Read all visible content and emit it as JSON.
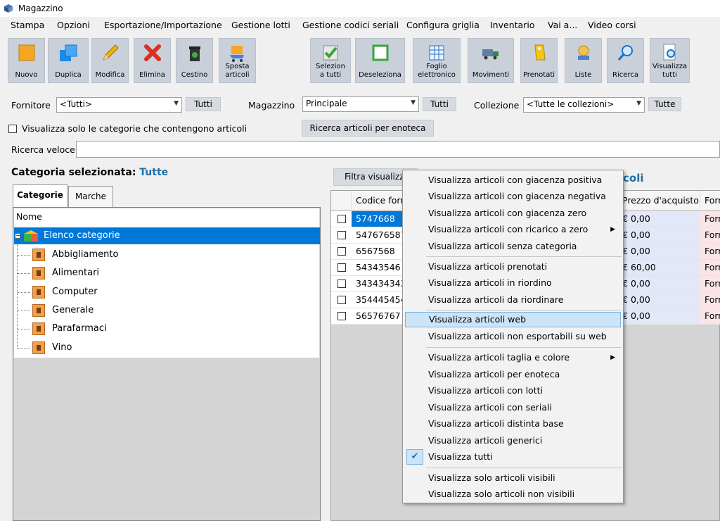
{
  "window": {
    "title": "Magazzino"
  },
  "menubar": [
    "Stampa",
    "Opzioni",
    "Esportazione/Importazione",
    "Gestione lotti",
    "Gestione codici seriali",
    "Configura griglia",
    "Inventario",
    "Vai a...",
    "Video corsi"
  ],
  "toolbar": {
    "nuovo": "Nuovo",
    "duplica": "Duplica",
    "modifica": "Modifica",
    "elimina": "Elimina",
    "cestino": "Cestino",
    "sposta_1": "Sposta",
    "sposta_2": "articoli",
    "seleziona_1": "Selezion",
    "seleziona_2": "a tutti",
    "deseleziona": "Deseleziona",
    "foglio_1": "Foglio",
    "foglio_2": "elettronico",
    "movimenti": "Movimenti",
    "prenotati": "Prenotati",
    "liste": "Liste",
    "ricerca": "Ricerca",
    "visualizza_1": "Visualizza",
    "visualizza_2": "tutti"
  },
  "filters": {
    "fornitore_label": "Fornitore",
    "fornitore_value": "<Tutti>",
    "fornitore_btn": "Tutti",
    "magazzino_label": "Magazzino",
    "magazzino_value": "Principale",
    "magazzino_btn": "Tutti",
    "collezione_label": "Collezione",
    "collezione_value": "<Tutte le collezioni>",
    "collezione_btn": "Tutte",
    "solo_categorie": "Visualizza solo le categorie che contengono articoli",
    "enoteca_btn": "Ricerca articoli per enoteca",
    "ricerca_label": "Ricerca veloce",
    "ricerca_value": ""
  },
  "left": {
    "categoria_label": "Categoria selezionata:",
    "categoria_value": "Tutte",
    "tabs": [
      "Categorie",
      "Marche"
    ],
    "tree_header": "Nome",
    "root": "Elenco categorie",
    "categories": [
      "Abbigliamento",
      "Alimentari",
      "Computer",
      "Generale",
      "Parafarmaci",
      "Vino"
    ]
  },
  "grid": {
    "filter_btn": "Filtra visualizza",
    "title_fragment": "coli",
    "columns": [
      "Codice forn",
      "Prezzo d'acquisto",
      "Forn"
    ],
    "rows": [
      {
        "code": "5747668",
        "price": "0,00",
        "forn": "Forn"
      },
      {
        "code": "547676587",
        "price": "0,00",
        "forn": "Forn"
      },
      {
        "code": "6567568",
        "price": "0,00",
        "forn": "Forn"
      },
      {
        "code": "54343546",
        "price": "60,00",
        "forn": "Forn"
      },
      {
        "code": "343434343",
        "price": "0,00",
        "forn": "Forn"
      },
      {
        "code": "354445454",
        "price": "0,00",
        "forn": "Forn"
      },
      {
        "code": "56576767",
        "price": "0,00",
        "forn": "Forn"
      }
    ]
  },
  "context_menu": {
    "items": [
      "Visualizza articoli con giacenza positiva",
      "Visualizza articoli con giacenza negativa",
      "Visualizza articoli con giacenza zero",
      "Visualizza articoli con ricarico a zero",
      "Visualizza articoli senza categoria",
      "Visualizza articoli prenotati",
      "Visualizza articoli in riordino",
      "Visualizza articoli da riordinare",
      "Visualizza articoli web",
      "Visualizza articoli non esportabili su web",
      "Visualizza articoli taglia e colore",
      "Visualizza articoli per enoteca",
      "Visualizza articoli con lotti",
      "Visualizza articoli con seriali",
      "Visualizza articoli distinta base",
      "Visualizza articoli generici",
      "Visualizza tutti",
      "Visualizza solo articoli visibili",
      "Visualizza solo articoli non visibili"
    ],
    "highlighted": "Visualizza articoli web",
    "checked": "Visualizza tutti",
    "check_glyph": "✔",
    "submenu_glyph": "▶"
  }
}
